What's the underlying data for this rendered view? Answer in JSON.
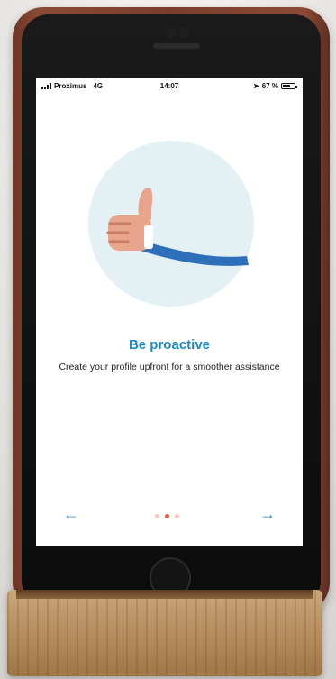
{
  "status_bar": {
    "carrier": "Proximus",
    "network": "4G",
    "time": "14:07",
    "battery_text": "67 %",
    "battery_level": 0.67
  },
  "onboarding": {
    "title": "Be proactive",
    "subtitle": "Create your profile upfront for a smoother assistance",
    "page_count": 3,
    "active_page": 2,
    "illustration_icon": "thumbs-up-icon",
    "prev_icon": "arrow-left-icon",
    "next_icon": "arrow-right-icon",
    "prev_symbol": "←",
    "next_symbol": "→"
  },
  "colors": {
    "accent": "#1a8cc8",
    "dot_active": "#e25a3c",
    "dot_inactive": "#f2c9c0",
    "illustration_bg": "#e3f0f4",
    "sleeve": "#2d6fb8",
    "case": "#7a3e2c"
  }
}
